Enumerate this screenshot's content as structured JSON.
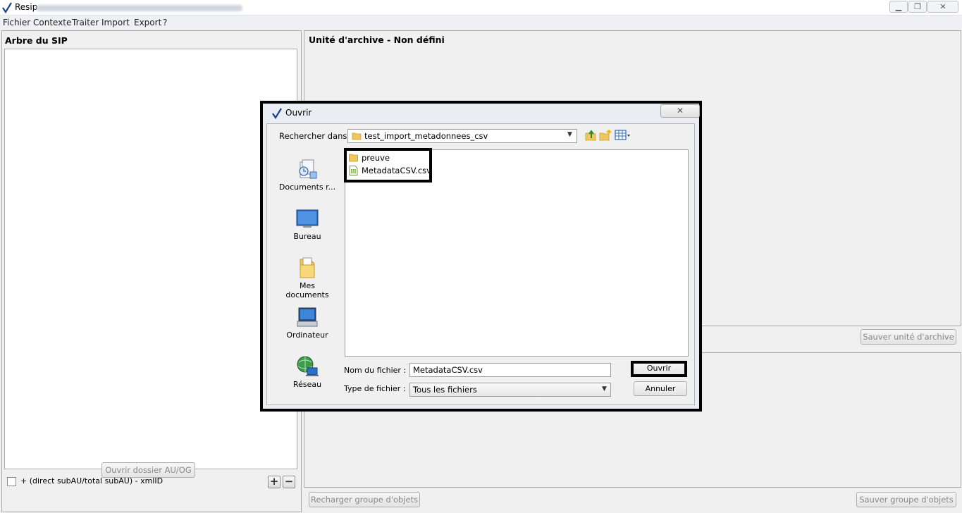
{
  "window": {
    "title": "Resip",
    "controls": {
      "minimize": "▁",
      "maximize": "❐",
      "close": "✕"
    }
  },
  "menu": [
    "Fichier",
    "Contexte",
    "Traiter",
    "Import",
    "Export",
    "?"
  ],
  "left_panel": {
    "title": "Arbre du SIP",
    "legend": "+ (direct subAU/total subAU) - xmlID",
    "open_dir_button": "Ouvrir dossier AU/OG",
    "add_icon": "+",
    "remove_icon": "−"
  },
  "right_panel": {
    "title": "Unité d'archive - Non défini",
    "save_au_button": "Sauver unité d'archive",
    "reload_group_button": "Recharger groupe d'objets",
    "save_group_button": "Sauver groupe d'objets"
  },
  "dialog": {
    "title": "Ouvrir",
    "close_glyph": "✕",
    "look_in_label": "Rechercher dans :",
    "look_in_value": "test_import_metadonnees_csv",
    "places": [
      {
        "label": "Documents r...",
        "icon": "recent-documents-icon"
      },
      {
        "label": "Bureau",
        "icon": "desktop-icon"
      },
      {
        "label": "Mes documents",
        "icon": "my-documents-icon"
      },
      {
        "label": "Ordinateur",
        "icon": "computer-icon"
      },
      {
        "label": "Réseau",
        "icon": "network-icon"
      }
    ],
    "files": [
      {
        "name": "preuve",
        "icon": "folder-icon"
      },
      {
        "name": "MetadataCSV.csv",
        "icon": "csv-file-icon"
      }
    ],
    "filename_label": "Nom du fichier :",
    "filename_value": "MetadataCSV.csv",
    "filetype_label": "Type de fichier :",
    "filetype_value": "Tous les fichiers",
    "open_button": "Ouvrir",
    "cancel_button": "Annuler"
  },
  "colors": {
    "highlight_border": "#000000",
    "app_background": "#f0f0f0",
    "dialog_background": "#eaeef3"
  }
}
